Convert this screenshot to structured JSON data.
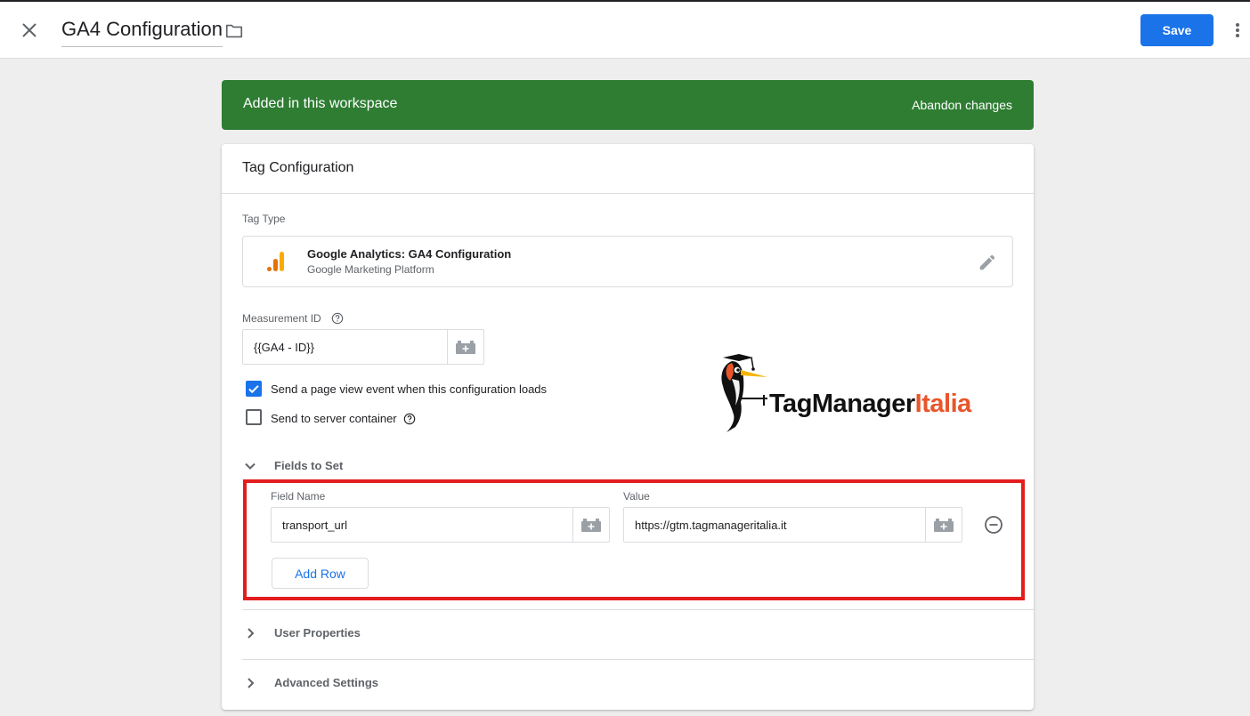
{
  "header": {
    "title": "GA4 Configuration",
    "save_label": "Save",
    "close_icon": "close-icon",
    "folder_icon": "folder-icon",
    "more_icon": "more-vert-icon"
  },
  "banner": {
    "text": "Added in this workspace",
    "action": "Abandon changes",
    "color": "#2e7d32"
  },
  "card": {
    "title": "Tag Configuration",
    "tag_type": {
      "label": "Tag Type",
      "name": "Google Analytics: GA4 Configuration",
      "provider": "Google Marketing Platform"
    },
    "measurement": {
      "label": "Measurement ID",
      "value": "{{GA4 - ID}}"
    },
    "checkboxes": [
      {
        "label": "Send a page view event when this configuration loads",
        "checked": true
      },
      {
        "label": "Send to server container",
        "checked": false
      }
    ],
    "fields_to_set": {
      "title": "Fields to Set",
      "field_name_label": "Field Name",
      "value_label": "Value",
      "rows": [
        {
          "field_name": "transport_url",
          "value": "https://gtm.tagmanageritalia.it"
        }
      ],
      "add_row_label": "Add Row"
    },
    "user_properties": {
      "title": "User Properties"
    },
    "advanced_settings": {
      "title": "Advanced Settings"
    }
  },
  "logo": {
    "text_dark": "TagManager",
    "text_orange": "Italia",
    "accent_color": "#e8552b"
  },
  "colors": {
    "primary": "#1a73e8",
    "highlight": "#e31d1d"
  }
}
